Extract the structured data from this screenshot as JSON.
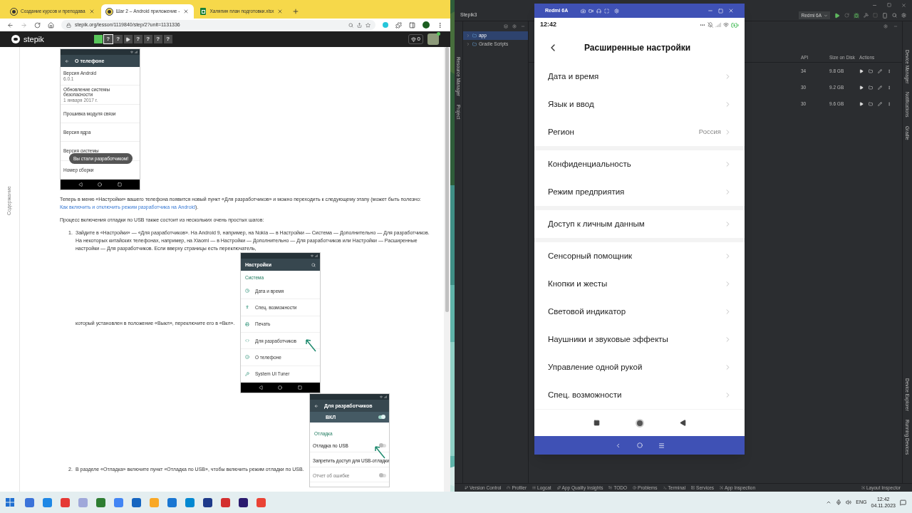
{
  "browser": {
    "tabs": [
      {
        "kind": "stepik",
        "title": "Создание курсов и преподава",
        "selected": false
      },
      {
        "kind": "stepik",
        "title": "Шаг 2 – Android приложение -",
        "selected": true
      },
      {
        "kind": "sheet",
        "title": "Халяпин план подготовки.xlsx",
        "selected": false
      }
    ],
    "url": "stepik.org/lesson/1119840/step/2?unit=1131336",
    "stepik": {
      "logo": "stepik",
      "points": "0",
      "steps": [
        {
          "kind": "done",
          "selected": false
        },
        {
          "kind": "question",
          "label": "?",
          "selected": true
        },
        {
          "kind": "question",
          "label": "?",
          "selected": false
        },
        {
          "kind": "video",
          "selected": false
        },
        {
          "kind": "question",
          "label": "?",
          "selected": false
        },
        {
          "kind": "question",
          "label": "?",
          "selected": false
        },
        {
          "kind": "question",
          "label": "?",
          "selected": false
        },
        {
          "kind": "question",
          "label": "?",
          "selected": false
        }
      ]
    },
    "sidebar_label": "Содержание",
    "content": {
      "screenshot_1": {
        "title": "О телефоне",
        "items": [
          {
            "label": "Версия Android",
            "value": "6.0.1"
          },
          {
            "label": "Обновление системы безопасности",
            "value": "1 января 2017 г."
          },
          {
            "label": "Прошивка модуля связи"
          },
          {
            "label": "Версия ядра"
          },
          {
            "label": "Версия системы"
          },
          {
            "label": "Номер сборки"
          }
        ],
        "toast": "Вы стали разработчиком!"
      },
      "paragraph_1": "Теперь в меню «Настройки» вашего телефона появится новый пункт «Для разработчиков» и можно переходить к следующему этапу (может быть полезно: ",
      "paragraph_1_link": "Как включить и отключить режим разработчика на Android",
      "paragraph_1_end": ").",
      "paragraph_2": "Процесс включения отладки по USB также состоит из нескольких очень простых шагов:",
      "step_1": {
        "number": "1.",
        "text": "Зайдите в «Настройки» — «Для разработчиков». На Android 9, например, на Nokia — в Настройки — Система — Дополнительно — Для разработчиков. На некоторых китайских телефонах, например, на Xiaomi — в Настройки — Дополнительно — Для разработчиков или Настройки — Расширенные настройки — Для разработчиков. Если вверху страницы есть переключатель,",
        "continuation": "который установлен в положение «Выкл», переключите его в «Вкл».",
        "screenshot": {
          "title": "Настройки",
          "section": "Система",
          "items": [
            {
              "label": "Дата и время",
              "pointed": false
            },
            {
              "label": "Спец. возможности",
              "pointed": false
            },
            {
              "label": "Печать",
              "pointed": false
            },
            {
              "label": "Для разработчиков",
              "pointed": true
            },
            {
              "label": "О телефоне",
              "pointed": false
            },
            {
              "label": "System UI Tuner",
              "pointed": false
            }
          ]
        }
      },
      "step_2": {
        "number": "2.",
        "text": "В разделе «Отладка» включите пункт «Отладка по USB», чтобы включить режим отладки по USB.",
        "screenshot": {
          "title": "Для разработчиков",
          "master": {
            "label": "ВКЛ",
            "on": true
          },
          "section": "Отладка",
          "items": [
            {
              "kind": "toggle",
              "label": "Отладка по USB",
              "on": false,
              "disabled": false,
              "pointed": true
            },
            {
              "kind": "plain",
              "label": "Запретить доступ для USB-отладки",
              "disabled": false,
              "pointed": false
            },
            {
              "kind": "toggle",
              "label": "Отчет об ошибке",
              "on": false,
              "disabled": true,
              "pointed": false
            }
          ]
        }
      }
    }
  },
  "studio": {
    "project": "Stepik3",
    "device": "Redmi 6A",
    "left_tools": [
      "Resource Manager",
      "Project"
    ],
    "tree": [
      {
        "label": "app",
        "selected": true
      },
      {
        "label": "Gradle Scripts",
        "selected": false
      }
    ],
    "columns": [
      "API",
      "Size on Disk",
      "Actions"
    ],
    "rows": [
      {
        "api": "34",
        "size": "9.8 GB"
      },
      {
        "api": "30",
        "size": "9.2 GB"
      },
      {
        "api": "30",
        "size": "9.6 GB"
      }
    ],
    "right_tools_top": [
      "Device Manager",
      "Notifications",
      "Gradle"
    ],
    "right_tools_bottom": [
      "Device Explorer",
      "Running Devices"
    ],
    "bottom_tools": [
      "Version Control",
      "Profiler",
      "Logcat",
      "App Quality Insights",
      "TODO",
      "Problems",
      "Terminal",
      "Services",
      "App Inspection"
    ],
    "bottom_right_tool": "Layout Inspector"
  },
  "emulator": {
    "title": "Redmi 6A",
    "time": "12:42",
    "screen_title": "Расширенные настройки",
    "groups": [
      [
        {
          "label": "Дата и время"
        },
        {
          "label": "Язык и ввод"
        },
        {
          "label": "Регион",
          "value": "Россия"
        }
      ],
      [
        {
          "label": "Конфиденциальность"
        },
        {
          "label": "Режим предприятия"
        }
      ],
      [
        {
          "label": "Доступ к личным данным"
        }
      ],
      [
        {
          "label": "Сенсорный помощник"
        },
        {
          "label": "Кнопки и жесты"
        },
        {
          "label": "Световой индикатор"
        },
        {
          "label": "Наушники и звуковые эффекты"
        },
        {
          "label": "Управление одной рукой"
        },
        {
          "label": "Спец. возможности"
        }
      ]
    ]
  },
  "taskbar": {
    "language": "ENG",
    "time": "12:42",
    "date": "04.11.2023"
  }
}
